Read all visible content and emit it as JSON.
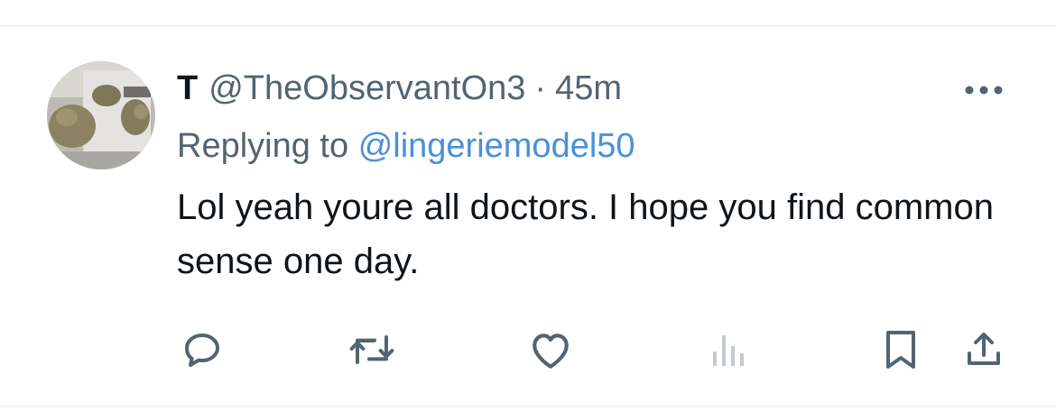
{
  "tweet": {
    "display_name": "T",
    "handle": "@TheObservantOn3",
    "separator": "·",
    "time": "45m",
    "reply_prefix": "Replying to",
    "reply_to": "@lingeriemodel50",
    "text": "Lol yeah youre all doctors. I hope you find common sense one day."
  },
  "icons": {
    "more": "more-horizontal-icon",
    "reply": "reply-icon",
    "retweet": "retweet-icon",
    "like": "heart-icon",
    "views": "views-icon",
    "bookmark": "bookmark-icon",
    "share": "share-icon"
  },
  "colors": {
    "text": "#0f1419",
    "secondary": "#536471",
    "link": "#4a90d9",
    "icon": "#536471",
    "divider": "#eff3f4"
  }
}
